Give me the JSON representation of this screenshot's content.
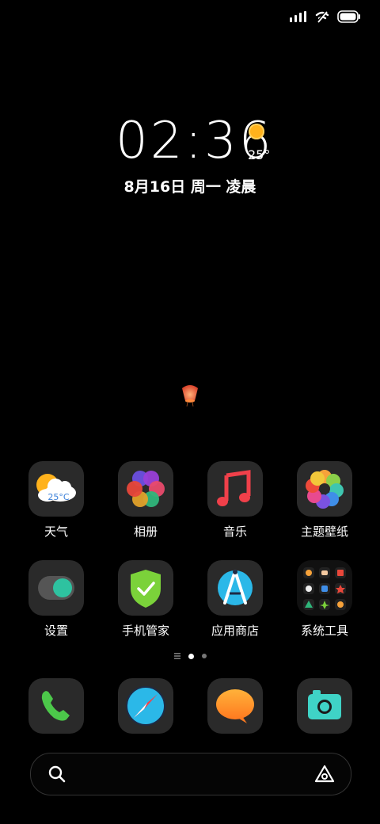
{
  "status_bar": {
    "icons": [
      "signal-icon",
      "wifi-off-icon",
      "battery-icon"
    ]
  },
  "clock": {
    "time": "02:36",
    "temperature": "25°",
    "date": "8月16日 周一 凌晨"
  },
  "apps_row1": [
    {
      "label": "天气",
      "icon": "weather-icon",
      "badge": "25°C"
    },
    {
      "label": "相册",
      "icon": "gallery-icon"
    },
    {
      "label": "音乐",
      "icon": "music-icon"
    },
    {
      "label": "主题壁纸",
      "icon": "themes-icon"
    }
  ],
  "apps_row2": [
    {
      "label": "设置",
      "icon": "settings-toggle-icon"
    },
    {
      "label": "手机管家",
      "icon": "security-shield-icon"
    },
    {
      "label": "应用商店",
      "icon": "app-store-icon"
    },
    {
      "label": "系统工具",
      "icon": "tools-folder-icon"
    }
  ],
  "dock": [
    {
      "icon": "phone-icon"
    },
    {
      "icon": "browser-icon"
    },
    {
      "icon": "messages-icon"
    },
    {
      "icon": "camera-icon"
    }
  ],
  "page_indicator": {
    "pages": 2,
    "current": 1
  },
  "colors": {
    "background": "#000000",
    "icon_tile": "#2a2a2a",
    "sun": "#ffb21c"
  }
}
